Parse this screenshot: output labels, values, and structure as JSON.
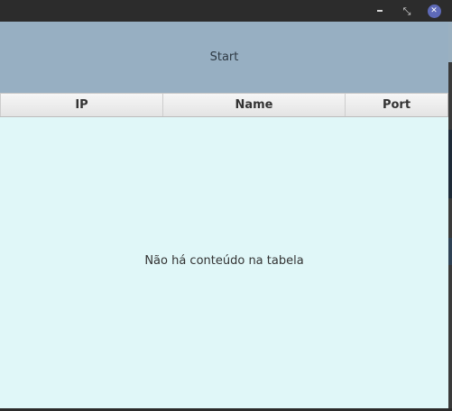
{
  "titlebar": {
    "minimize_icon": "minimize-icon",
    "maximize_icon": "restore-icon",
    "close_icon": "close-icon",
    "close_glyph": "✕",
    "restore_glyph": "⤡"
  },
  "start": {
    "label": "Start"
  },
  "table": {
    "columns": [
      "IP",
      "Name",
      "Port"
    ],
    "empty_message": "Não há conteúdo na tabela"
  },
  "colors": {
    "start_background": "#97afc2",
    "table_background": "#e0f7f8",
    "close_button": "#5e6ab8"
  }
}
